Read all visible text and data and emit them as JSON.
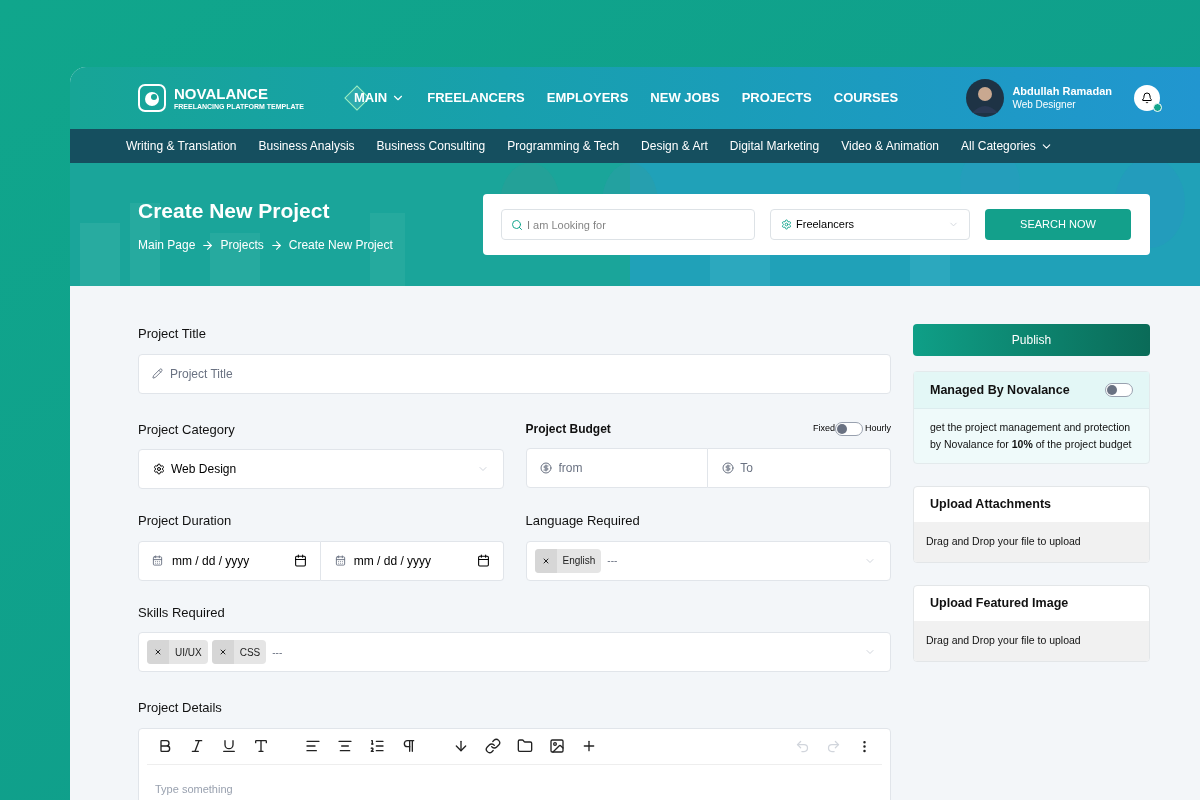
{
  "brand": {
    "name": "NOVALANCE",
    "tagline": "FREELANCING PLATFORM TEMPLATE"
  },
  "nav": [
    {
      "label": "MAIN",
      "selected": true,
      "dropdown": true
    },
    {
      "label": "FREELANCERS",
      "selected": false,
      "dropdown": false
    },
    {
      "label": "EMPLOYERS",
      "selected": false,
      "dropdown": false
    },
    {
      "label": "NEW JOBS",
      "selected": false,
      "dropdown": false
    },
    {
      "label": "PROJECTS",
      "selected": false,
      "dropdown": false
    },
    {
      "label": "COURSES",
      "selected": false,
      "dropdown": false
    }
  ],
  "user": {
    "name": "Abdullah Ramadan",
    "role": "Web Designer",
    "online": true
  },
  "categories": [
    {
      "label": "Writing & Translation",
      "dropdown": false
    },
    {
      "label": "Business Analysis",
      "dropdown": false
    },
    {
      "label": "Business Consulting",
      "dropdown": false
    },
    {
      "label": "Programming & Tech",
      "dropdown": false
    },
    {
      "label": "Design & Art",
      "dropdown": false
    },
    {
      "label": "Digital Marketing",
      "dropdown": false
    },
    {
      "label": "Video & Animation",
      "dropdown": false
    },
    {
      "label": "All Categories",
      "dropdown": true
    }
  ],
  "hero": {
    "title": "Create New Project",
    "breadcrumbs": [
      "Main Page",
      "Projects",
      "Create New Project"
    ]
  },
  "search": {
    "placeholder": "I am Looking for",
    "type_value": "Freelancers",
    "button": "SEARCH NOW"
  },
  "form": {
    "title": {
      "label": "Project Title",
      "placeholder": "Project Title"
    },
    "category": {
      "label": "Project Category",
      "value": "Web Design"
    },
    "budget": {
      "label": "Project Budget",
      "left_option": "Fixed",
      "right_option": "Hourly",
      "hourly": false,
      "from_placeholder": "from",
      "to_placeholder": "To"
    },
    "duration": {
      "label": "Project Duration",
      "start_placeholder": "mm / dd / yyyy",
      "end_placeholder": "mm / dd / yyyy"
    },
    "language": {
      "label": "Language Required",
      "tags": [
        "English"
      ],
      "rest": "---"
    },
    "skills": {
      "label": "Skills Required",
      "tags": [
        "UI/UX",
        "CSS"
      ],
      "rest": "---"
    },
    "details": {
      "label": "Project Details",
      "placeholder": "Type something"
    }
  },
  "sidebar": {
    "publish": "Publish",
    "managed": {
      "title": "Managed By Novalance",
      "on": false,
      "text": "get the project management and protection by Novalance for **10%** of the project budget"
    },
    "uploads": [
      {
        "title": "Upload Attachments",
        "hint": "Drag and Drop your file to upload"
      },
      {
        "title": "Upload Featured Image",
        "hint": "Drag and Drop your file to upload"
      }
    ]
  }
}
